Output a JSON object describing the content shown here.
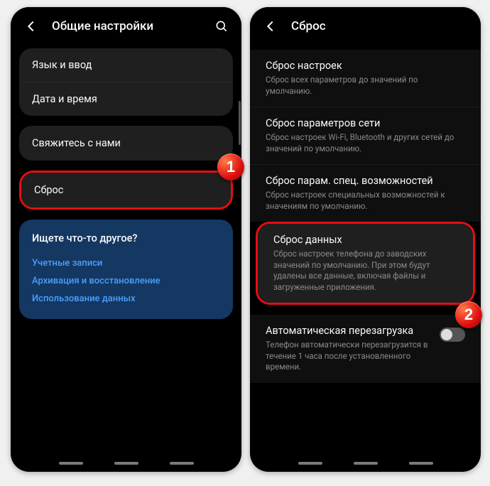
{
  "left": {
    "title": "Общие настройки",
    "group1": {
      "lang": "Язык и ввод",
      "date": "Дата и время"
    },
    "contact": "Свяжитесь с нами",
    "reset": "Сброс",
    "other": {
      "title": "Ищете что-то другое?",
      "links": {
        "accounts": "Учетные записи",
        "backup": "Архивация и восстановление",
        "data": "Использование данных"
      }
    }
  },
  "right": {
    "title": "Сброс",
    "items": {
      "settings": {
        "t": "Сброс настроек",
        "s": "Сброс всех параметров до значений по умолчанию."
      },
      "network": {
        "t": "Сброс параметров сети",
        "s": "Сброс настроек Wi-Fi, Bluetooth и других сетей до значений по умолчанию."
      },
      "access": {
        "t": "Сброс парам. спец. возможностей",
        "s": "Сброс настроек специальных возможностей к значениям по умолчанию."
      },
      "factory": {
        "t": "Сброс данных",
        "s": "Сброс настроек телефона до заводских значений по умолчанию. При этом будут удалены все данные, включая файлы и загруженные приложения."
      },
      "auto": {
        "t": "Автоматическая перезагрузка",
        "s": "Телефон автоматически перезагрузится в течение 1 часа после установленного времени."
      }
    }
  },
  "badges": {
    "b1": "1",
    "b2": "2"
  }
}
